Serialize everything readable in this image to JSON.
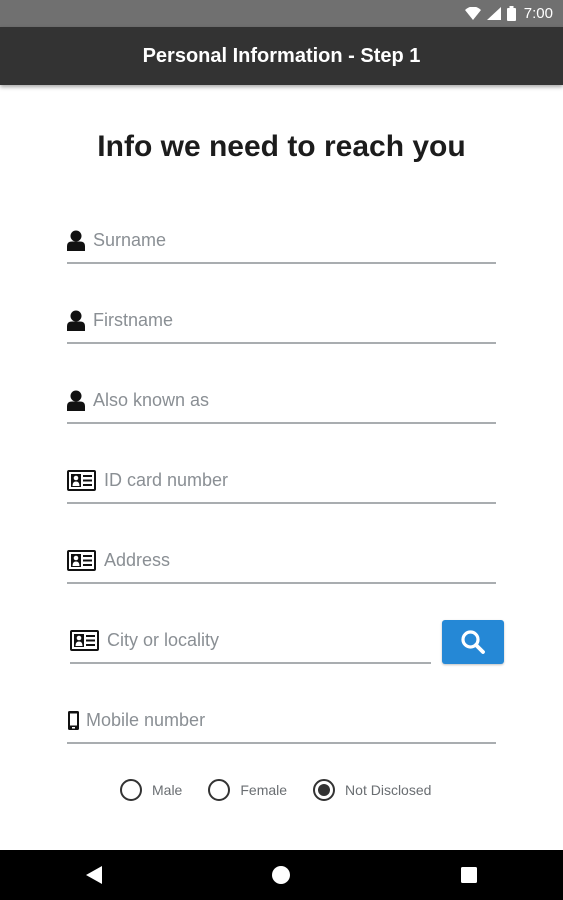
{
  "status_bar": {
    "time": "7:00"
  },
  "app_bar": {
    "title": "Personal Information - Step 1"
  },
  "form": {
    "heading": "Info we need to reach you",
    "fields": {
      "surname": {
        "placeholder": "Surname",
        "icon": "person-icon"
      },
      "firstname": {
        "placeholder": "Firstname",
        "icon": "person-icon"
      },
      "alias": {
        "placeholder": "Also known as",
        "icon": "person-icon"
      },
      "id_card": {
        "placeholder": "ID card number",
        "icon": "id-card-icon"
      },
      "address": {
        "placeholder": "Address",
        "icon": "id-card-icon"
      },
      "city": {
        "placeholder": "City or locality",
        "icon": "id-card-icon"
      },
      "mobile": {
        "placeholder": "Mobile number",
        "icon": "mobile-phone-icon"
      }
    },
    "search_button": {
      "icon": "search-icon",
      "color": "#2588d6"
    },
    "gender": {
      "options": [
        "Male",
        "Female",
        "Not Disclosed"
      ],
      "selected": "Not Disclosed"
    }
  },
  "colors": {
    "status_bar": "#707070",
    "app_bar": "#333333",
    "accent": "#2588d6",
    "underline": "#a9adb0"
  }
}
